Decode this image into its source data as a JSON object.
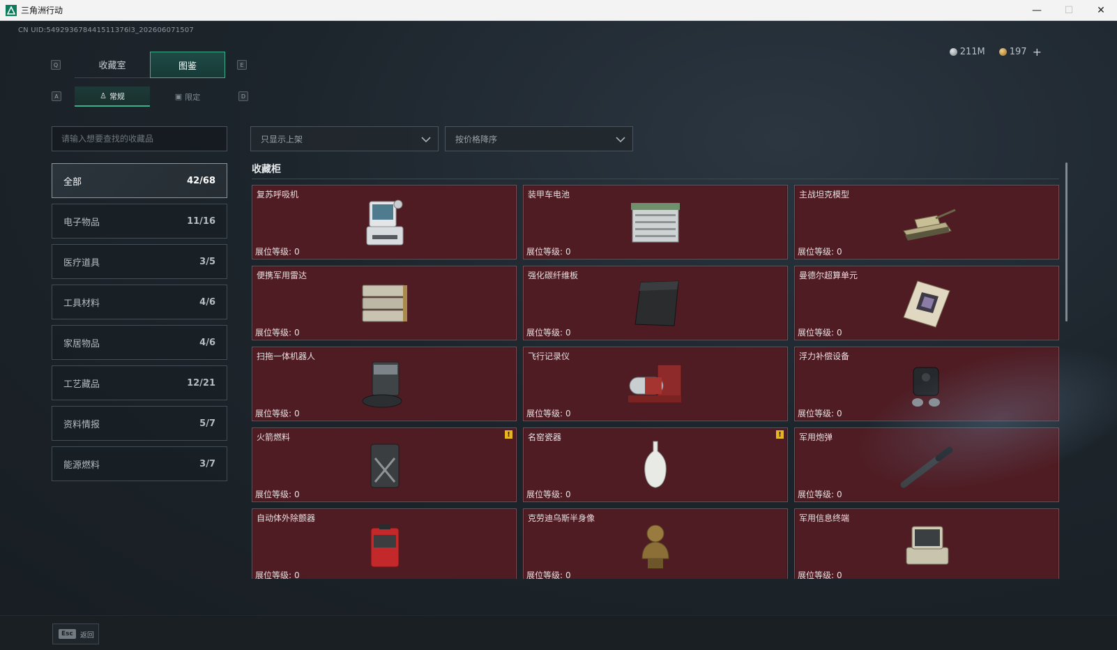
{
  "window": {
    "title": "三角洲行动",
    "minimize": "—",
    "maximize": "☐",
    "close": "✕"
  },
  "uid": "CN UID:549293678441511376l3_202606071507",
  "currency": {
    "silver": "211M",
    "gold": "197",
    "plus": "+"
  },
  "tabs": {
    "key_left": "Q",
    "key_right": "E",
    "items": [
      "收藏室",
      "图鉴"
    ],
    "active": "图鉴"
  },
  "subtabs": {
    "key_left": "A",
    "key_right": "D",
    "items": [
      "常规",
      "限定"
    ],
    "active": "常规"
  },
  "search": {
    "placeholder": "请输入想要查找的收藏品"
  },
  "filters": {
    "shelf": "只显示上架",
    "sort": "按价格降序"
  },
  "categories": [
    {
      "name": "全部",
      "count": "42/68"
    },
    {
      "name": "电子物品",
      "count": "11/16"
    },
    {
      "name": "医疗道具",
      "count": "3/5"
    },
    {
      "name": "工具材料",
      "count": "4/6"
    },
    {
      "name": "家居物品",
      "count": "4/6"
    },
    {
      "name": "工艺藏品",
      "count": "12/21"
    },
    {
      "name": "资料情报",
      "count": "5/7"
    },
    {
      "name": "能源燃料",
      "count": "3/7"
    }
  ],
  "cabinet": {
    "title": "收藏柜",
    "level_label": "展位等级:",
    "warn_mark": "!",
    "items": [
      {
        "name": "复苏呼吸机",
        "level": "0"
      },
      {
        "name": "装甲车电池",
        "level": "0"
      },
      {
        "name": "主战坦克模型",
        "level": "0"
      },
      {
        "name": "便携军用雷达",
        "level": "0"
      },
      {
        "name": "强化碳纤维板",
        "level": "0"
      },
      {
        "name": "曼德尔超算单元",
        "level": "0"
      },
      {
        "name": "扫拖一体机器人",
        "level": "0"
      },
      {
        "name": "飞行记录仪",
        "level": "0"
      },
      {
        "name": "浮力补偿设备",
        "level": "0"
      },
      {
        "name": "火箭燃料",
        "level": "0"
      },
      {
        "name": "名窑瓷器",
        "level": "0"
      },
      {
        "name": "军用炮弹",
        "level": "0"
      },
      {
        "name": "自动体外除颤器",
        "level": "0"
      },
      {
        "name": "克劳迪乌斯半身像",
        "level": "0"
      },
      {
        "name": "军用信息终端",
        "level": "0"
      }
    ]
  },
  "footer": {
    "esc_key": "Esc",
    "back_label": "返回"
  }
}
